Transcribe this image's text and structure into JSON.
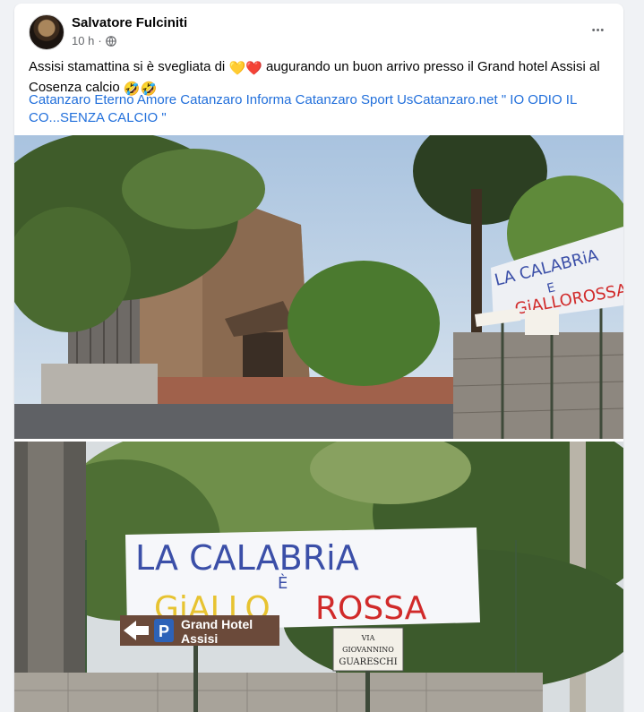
{
  "post": {
    "author": "Salvatore Fulciniti",
    "time": "10 h",
    "separator": "·",
    "text_before": "Assisi stamattina si è svegliata di ",
    "text_emoji1": "💛❤️",
    "text_after": " augurando un buon arrivo presso il Grand hotel Assisi al Cosenza calcio ",
    "text_emoji2": "🤣🤣",
    "tags": [
      "Catanzaro Eterno Amore",
      "Catanzaro Informa",
      "Catanzaro Sport",
      "UsCatanzaro.net",
      "\" IO ODIO IL CO...SENZA CALCIO \""
    ],
    "more_glyph": "•••"
  },
  "photo1": {
    "banner_line1": "LA CALABRiA",
    "banner_line2": "E",
    "banner_line3": "GiALLOROSSA"
  },
  "photo2": {
    "banner_line1": "LA CALABRiA",
    "banner_line2": "È",
    "banner_yellow": "GiALLO",
    "banner_red": "ROSSA",
    "sign_p": "P",
    "sign_line1": "Grand Hotel",
    "sign_line2": "Assisi",
    "street_line1": "VIA",
    "street_line2": "GIOVANNINO",
    "street_line3": "GUARESCHI"
  },
  "colors": {
    "link": "#216fdb",
    "banner_blue": "#3b4fa8",
    "banner_yellow": "#e7c331",
    "banner_red": "#d12a2a",
    "sign_brown": "#6b4a3a"
  },
  "icons": [
    "globe-icon",
    "more-icon"
  ]
}
